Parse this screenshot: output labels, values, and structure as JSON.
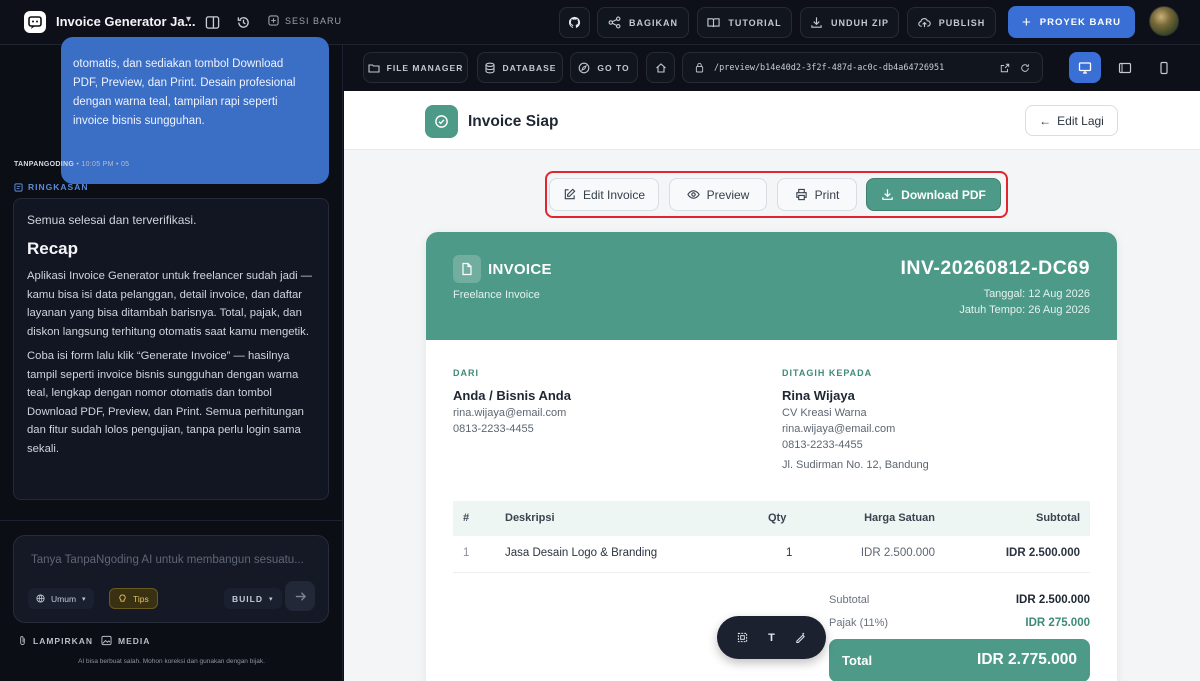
{
  "topbar": {
    "project_title": "Invoice Generator Ja...",
    "new_session": "SESI BARU",
    "share": "BAGIKAN",
    "tutorial": "TUTORIAL",
    "download_zip": "UNDUH ZIP",
    "publish": "PUBLISH",
    "new_project": "PROYEK BARU"
  },
  "chat": {
    "bubble_lines": [
      "otomatis, dan sediakan tombol Download",
      "PDF, Preview, dan Print. Desain profesional",
      "dengan warna teal, tampilan rapi seperti",
      "invoice bisnis sungguhan."
    ],
    "sender": "TANPANGODING",
    "time": "• 10:05 PM • 05",
    "summary_label": "RINGKASAN",
    "done_text": "Semua selesai dan terverifikasi.",
    "recap_title": "Recap",
    "recap_p1": "Aplikasi Invoice Generator untuk freelancer sudah jadi — kamu bisa isi data pelanggan, detail invoice, dan daftar layanan yang bisa ditambah barisnya. Total, pajak, dan diskon langsung terhitung otomatis saat kamu mengetik.",
    "recap_p2": "Coba isi form lalu klik “Generate Invoice” — hasilnya tampil seperti invoice bisnis sungguhan dengan warna teal, lengkap dengan nomor otomatis dan tombol Download PDF, Preview, dan Print. Semua perhitungan dan fitur sudah lolos pengujian, tanpa perlu login sama sekali.",
    "input_placeholder": "Tanya TanpaNgoding AI untuk membangun sesuatu...",
    "mode": "Umum",
    "tips": "Tips",
    "build": "BUILD",
    "attach": "LAMPIRKAN",
    "media": "MEDIA",
    "disclaimer": "AI bisa berbuat salah. Mohon koreksi dan gunakan dengan bijak."
  },
  "toolbar": {
    "file_manager": "FILE MANAGER",
    "database": "DATABASE",
    "goto": "GO TO",
    "url": "/preview/b14e40d2-3f2f-487d-ac0c-db4a64726951",
    "active_device": "desktop"
  },
  "preview": {
    "title": "Invoice Siap",
    "edit_again": "Edit Lagi",
    "actions": {
      "edit": "Edit Invoice",
      "preview": "Preview",
      "print": "Print",
      "download": "Download PDF"
    },
    "invoice": {
      "label": "INVOICE",
      "subtitle": "Freelance Invoice",
      "number": "INV-20260812-DC69",
      "date": "Tanggal: 12 Aug 2026",
      "due": "Jatuh Tempo: 26 Aug 2026",
      "from_label": "DARI",
      "from_name": "Anda / Bisnis Anda",
      "from_email": "rina.wijaya@email.com",
      "from_phone": "0813-2233-4455",
      "to_label": "DITAGIH KEPADA",
      "to_name": "Rina Wijaya",
      "to_company": "CV Kreasi Warna",
      "to_email": "rina.wijaya@email.com",
      "to_phone": "0813-2233-4455",
      "to_address": "Jl. Sudirman No. 12, Bandung",
      "columns": [
        "#",
        "Deskripsi",
        "Qty",
        "Harga Satuan",
        "Subtotal"
      ],
      "rows": [
        {
          "no": "1",
          "desc": "Jasa Desain Logo & Branding",
          "qty": "1",
          "price": "IDR 2.500.000",
          "subtotal": "IDR 2.500.000"
        }
      ],
      "subtotal_label": "Subtotal",
      "subtotal_value": "IDR 2.500.000",
      "tax_label": "Pajak (11%)",
      "tax_value": "IDR 275.000",
      "total_label": "Total",
      "total_value": "IDR 2.775.000"
    },
    "float_text_tool": "T"
  },
  "colors": {
    "teal": "#4e9a88",
    "accent_blue": "#3a6fd6",
    "highlight_red": "#e0252f"
  }
}
